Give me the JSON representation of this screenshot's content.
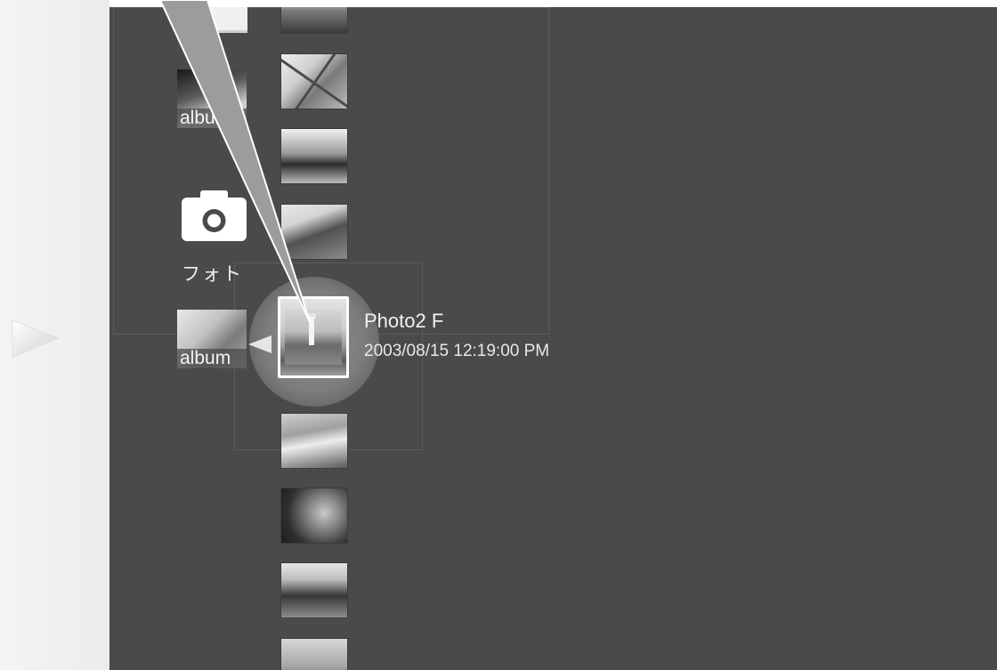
{
  "menu": {
    "category_label": "フォト",
    "album_label": "album",
    "selected_item": {
      "title": "Photo2 F",
      "datetime": "2003/08/15 12:19:00 PM"
    }
  },
  "icons": {
    "category": "camera-icon",
    "selection_marker": "play-arrow-icon"
  },
  "colors": {
    "background": "#4a4a4a",
    "text": "#f0f0f0",
    "highlight": "#7c7c7c"
  }
}
